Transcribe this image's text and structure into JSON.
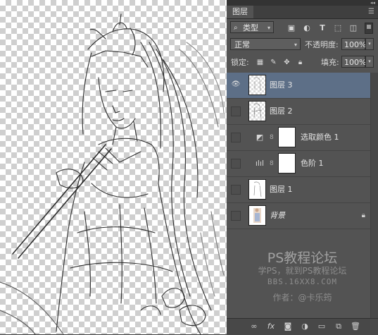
{
  "panel": {
    "tab_title": "图层",
    "filter": {
      "kind_label": "类型"
    },
    "blend_mode": "正常",
    "opacity_label": "不透明度:",
    "opacity_value": "100%",
    "lock_label": "锁定:",
    "fill_label": "填充:",
    "fill_value": "100%"
  },
  "layers": [
    {
      "name": "图层 3",
      "visible": true,
      "selected": true,
      "type": "pixel"
    },
    {
      "name": "图层 2",
      "visible": false,
      "selected": false,
      "type": "pixel"
    },
    {
      "name": "选取颜色 1",
      "visible": false,
      "selected": false,
      "type": "adjustment",
      "icon": "selective-color-icon"
    },
    {
      "name": "色阶 1",
      "visible": false,
      "selected": false,
      "type": "adjustment",
      "icon": "levels-icon"
    },
    {
      "name": "图层 1",
      "visible": false,
      "selected": false,
      "type": "pixel"
    },
    {
      "name": "背景",
      "visible": false,
      "selected": false,
      "type": "background",
      "locked": true
    }
  ],
  "watermark": {
    "title": "PS教程论坛",
    "slogan": "学PS，就到PS教程论坛",
    "url": "BBS.16XX8.COM",
    "author": "作者：@卡乐筠"
  },
  "icons": {
    "filter_row": [
      "pixel-filter-icon",
      "adjustment-filter-icon",
      "type-filter-icon",
      "shape-filter-icon",
      "smart-object-filter-icon"
    ],
    "lock_row": [
      "lock-transparent-icon",
      "lock-image-icon",
      "lock-position-icon",
      "lock-all-icon"
    ],
    "bottom_bar": [
      "link-layers-icon",
      "fx-icon",
      "add-mask-icon",
      "new-adjustment-icon",
      "new-group-icon",
      "new-layer-icon",
      "delete-icon"
    ]
  },
  "colors": {
    "panel_bg": "#535353",
    "selected_layer": "#5d6f87",
    "toolbar_bg": "#484848"
  }
}
